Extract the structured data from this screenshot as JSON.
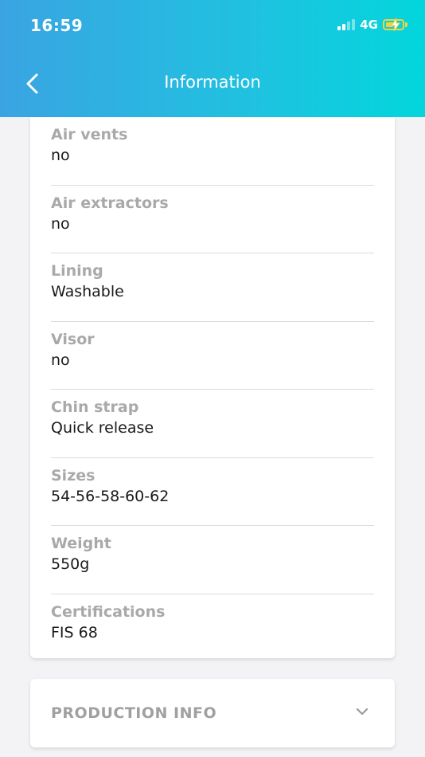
{
  "status_bar": {
    "time": "16:59",
    "network": "4G"
  },
  "header": {
    "title": "Information"
  },
  "specs": [
    {
      "label": "Air vents",
      "value": "no"
    },
    {
      "label": "Air extractors",
      "value": "no"
    },
    {
      "label": "Lining",
      "value": "Washable"
    },
    {
      "label": "Visor",
      "value": "no"
    },
    {
      "label": "Chin strap",
      "value": "Quick release"
    },
    {
      "label": "Sizes",
      "value": "54-56-58-60-62"
    },
    {
      "label": "Weight",
      "value": "550g"
    },
    {
      "label": "Certifications",
      "value": "FIS 68"
    }
  ],
  "production_section": {
    "label": "PRODUCTION INFO"
  },
  "colors": {
    "header_start": "#3aa4e2",
    "header_end": "#02d6dc",
    "battery": "#f5d13b"
  },
  "icons": {
    "back": "chevron-left-icon",
    "expand": "chevron-down-icon",
    "battery": "battery-charging-icon",
    "signal": "signal-icon"
  }
}
